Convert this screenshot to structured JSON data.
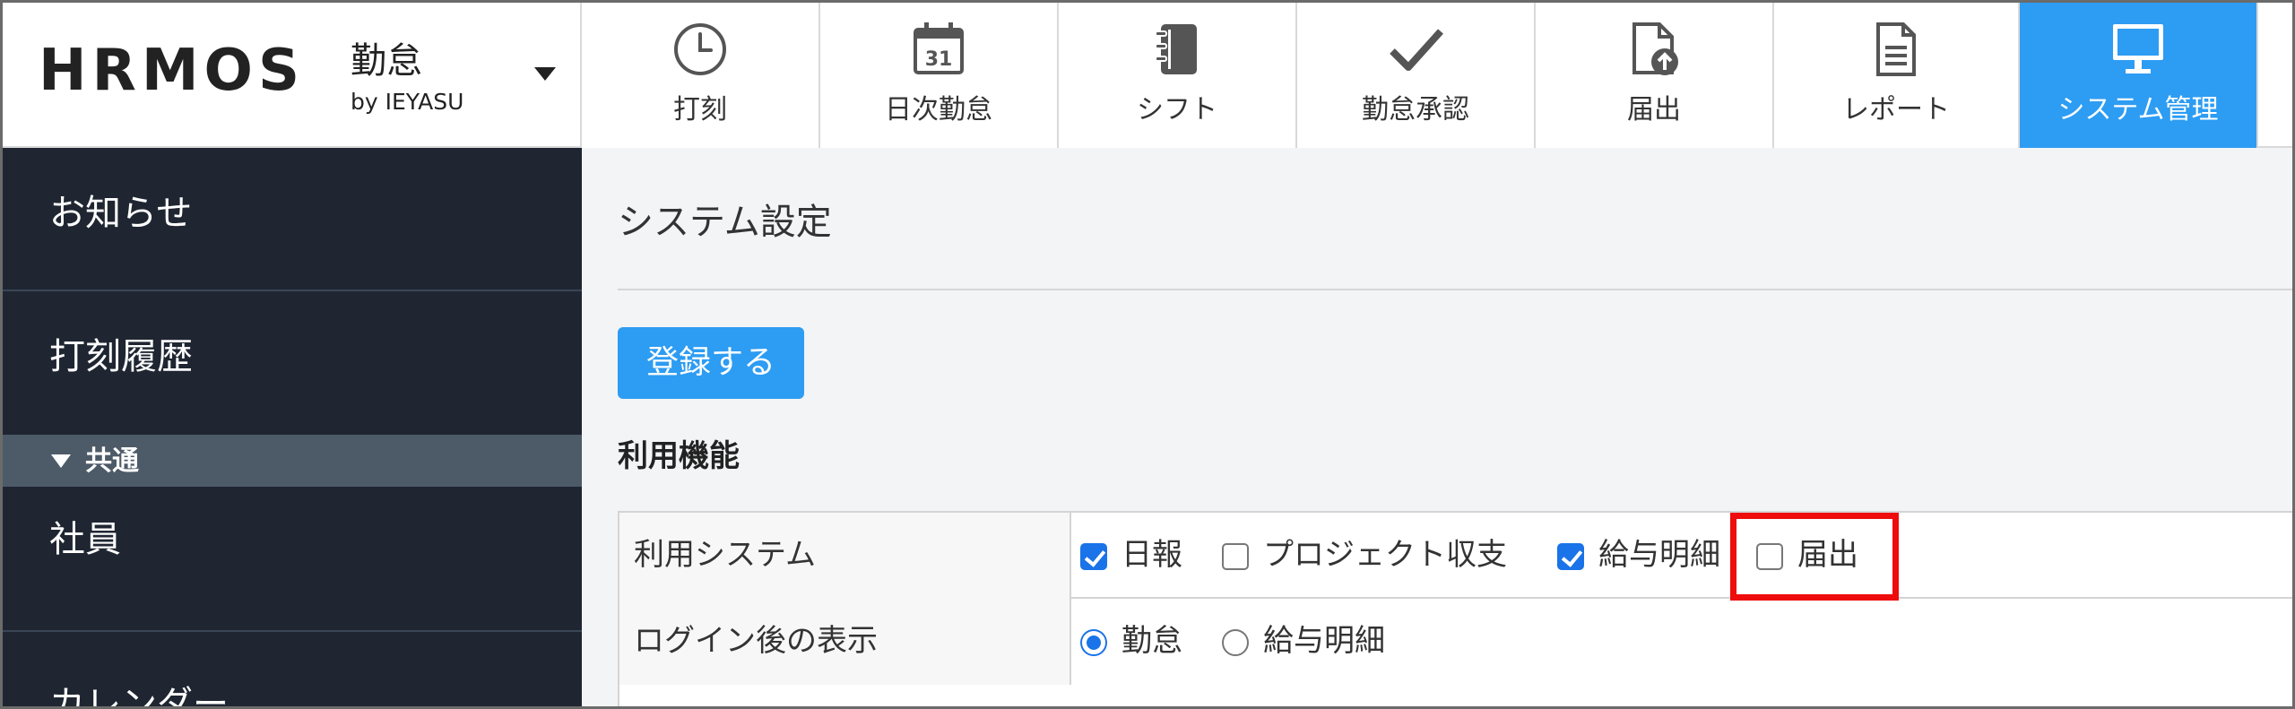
{
  "header": {
    "logo_text": "HRMOS",
    "product_name": "勤怠",
    "by_line": "by IEYASU",
    "tabs": [
      {
        "label": "打刻",
        "icon": "clock-icon",
        "active": false
      },
      {
        "label": "日次勤怠",
        "icon": "calendar-icon",
        "active": false
      },
      {
        "label": "シフト",
        "icon": "notebook-icon",
        "active": false
      },
      {
        "label": "勤怠承認",
        "icon": "checkmark-icon",
        "active": false
      },
      {
        "label": "届出",
        "icon": "document-upload-icon",
        "active": false
      },
      {
        "label": "レポート",
        "icon": "report-document-icon",
        "active": false
      },
      {
        "label": "システム管理",
        "icon": "monitor-icon",
        "active": true
      }
    ],
    "calendar_day": "31"
  },
  "sidebar": {
    "items": [
      {
        "label": "お知らせ"
      },
      {
        "label": "打刻履歴"
      }
    ],
    "section": {
      "label": "共通"
    },
    "section_items": [
      {
        "label": "社員"
      },
      {
        "label": "カレンダー"
      }
    ]
  },
  "main": {
    "title": "システム設定",
    "register_button": "登録する",
    "section_heading": "利用機能",
    "rows": [
      {
        "label": "利用システム",
        "options": [
          {
            "label": "日報",
            "checked": true
          },
          {
            "label": "プロジェクト収支",
            "checked": false
          },
          {
            "label": "給与明細",
            "checked": true
          },
          {
            "label": "届出",
            "checked": false
          }
        ]
      },
      {
        "label": "ログイン後の表示",
        "options": [
          {
            "label": "勤怠",
            "selected": true
          },
          {
            "label": "給与明細",
            "selected": false
          }
        ]
      }
    ]
  },
  "colors": {
    "accent": "#2d9cf3",
    "sidebar_bg": "#1f2632",
    "sidebar_section_bg": "#4d5a68",
    "highlight": "#ee0c0c",
    "checkbox_checked": "#1a73e8"
  }
}
